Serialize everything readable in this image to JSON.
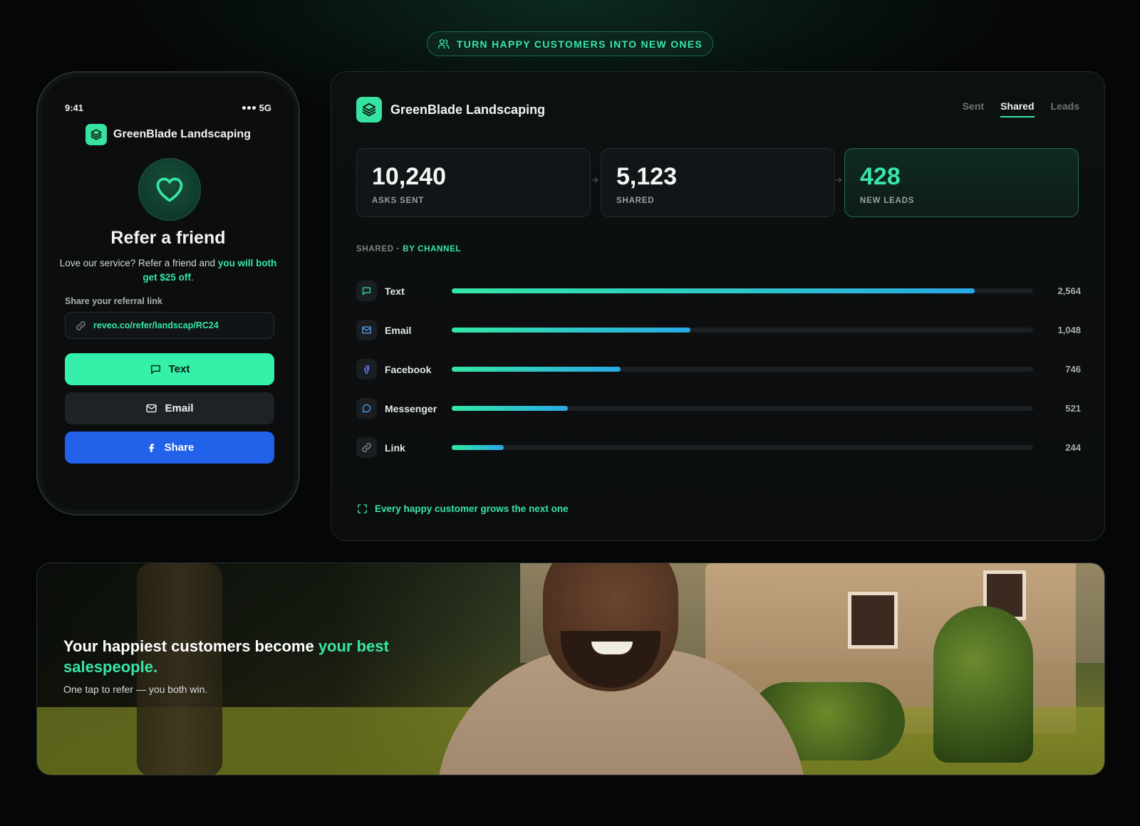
{
  "top_pill": {
    "label": "TURN HAPPY CUSTOMERS INTO NEW ONES",
    "icon": "users-icon"
  },
  "phone": {
    "time": "9:41",
    "network": "5G",
    "brand": "GreenBlade Landscaping",
    "title": "Refer a friend",
    "desc_prefix": "Love our service? Refer a friend and ",
    "desc_highlight": "you will both get $25 off",
    "desc_suffix": ".",
    "share_label": "Share your referral link",
    "referral_link": "reveo.co/refer/landscap/RC24",
    "buttons": {
      "text": "Text",
      "email": "Email",
      "share": "Share"
    }
  },
  "dashboard": {
    "brand": "GreenBlade Landscaping",
    "tabs": [
      {
        "label": "Sent"
      },
      {
        "label": "Shared",
        "active": true
      },
      {
        "label": "Leads"
      }
    ],
    "stats": [
      {
        "value": "10,240",
        "label": "ASKS SENT"
      },
      {
        "value": "5,123",
        "label": "SHARED"
      },
      {
        "value": "428",
        "label": "NEW LEADS"
      }
    ],
    "section_prefix": "SHARED",
    "section_suffix": " · BY CHANNEL",
    "channels": [
      {
        "label": "Text",
        "value": "2,564",
        "share": 0.9,
        "icon": "message-square-icon"
      },
      {
        "label": "Email",
        "value": "1,048",
        "share": 0.41,
        "icon": "mail-icon"
      },
      {
        "label": "Facebook",
        "value": "746",
        "share": 0.29,
        "icon": "facebook-icon"
      },
      {
        "label": "Messenger",
        "value": "521",
        "share": 0.2,
        "icon": "message-circle-icon"
      },
      {
        "label": "Link",
        "value": "244",
        "share": 0.09,
        "icon": "link-icon"
      }
    ],
    "tagline": "Every happy customer grows the next one"
  },
  "banner": {
    "headline_prefix": "Your happiest customers become ",
    "headline_highlight": "your best salespeople.",
    "subline": "One tap to refer — you both win."
  },
  "colors": {
    "accent": "#38e6a8",
    "share_button": "#2261ea",
    "text_button": "#35f0a9"
  }
}
